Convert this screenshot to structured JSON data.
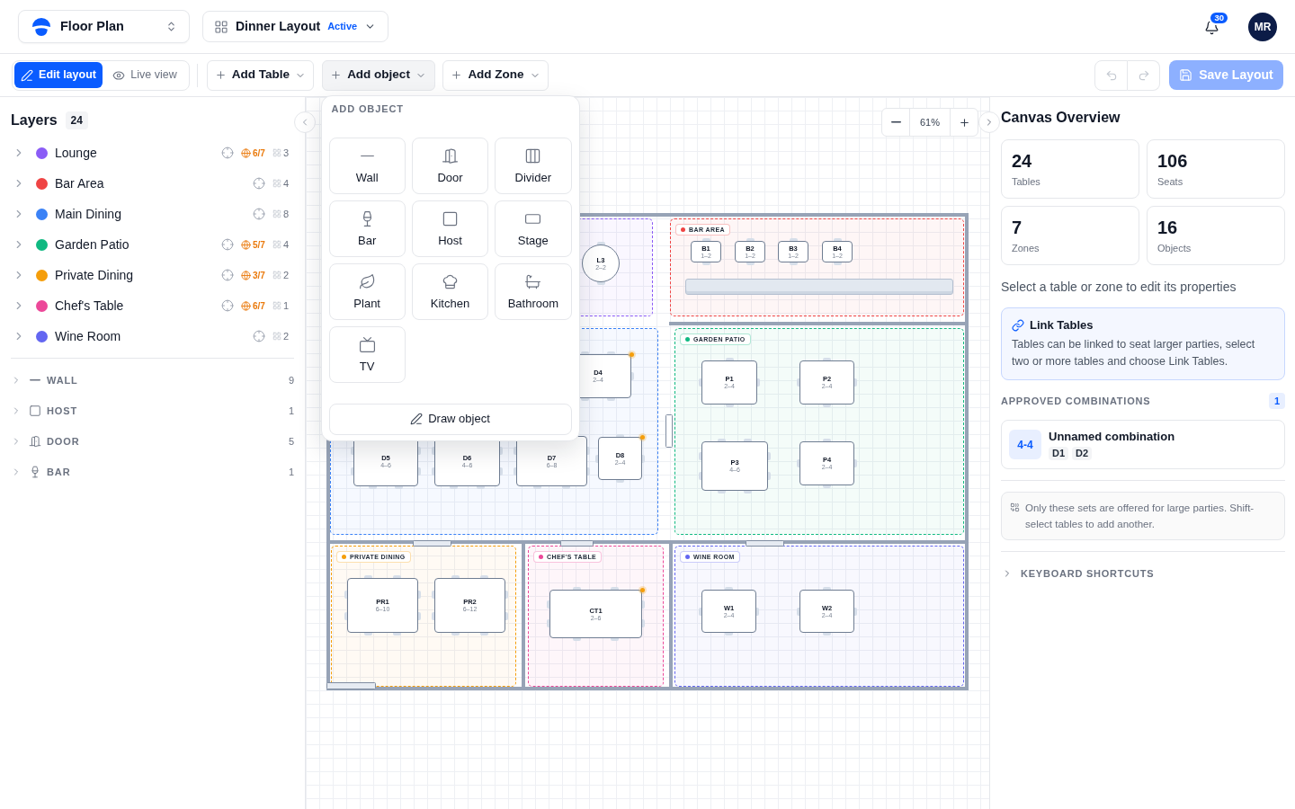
{
  "header": {
    "workspace": {
      "label": "Floor Plan"
    },
    "layout": {
      "label": "Dinner Layout",
      "status": "Active"
    },
    "notifications": {
      "count": "30"
    },
    "user": {
      "initials": "MR"
    }
  },
  "toolbar": {
    "modes": [
      {
        "label": "Edit layout",
        "selected": true
      },
      {
        "label": "Live view",
        "selected": false
      }
    ],
    "add_menus": [
      {
        "label": "Add Table",
        "open": false
      },
      {
        "label": "Add object",
        "open": true
      },
      {
        "label": "Add Zone",
        "open": false
      }
    ],
    "undo": {
      "disabled": true
    },
    "redo": {
      "disabled": true
    },
    "save": {
      "label": "Save Layout",
      "disabled": true
    }
  },
  "add_object_menu": {
    "title": "ADD OBJECT",
    "items": [
      {
        "label": "Wall"
      },
      {
        "label": "Door"
      },
      {
        "label": "Divider"
      },
      {
        "label": "Bar"
      },
      {
        "label": "Host"
      },
      {
        "label": "Stage"
      },
      {
        "label": "Plant"
      },
      {
        "label": "Kitchen"
      },
      {
        "label": "Bathroom"
      },
      {
        "label": "TV"
      }
    ],
    "draw_button": "Draw object"
  },
  "layers": {
    "title": "Layers",
    "count": "24",
    "zones": [
      {
        "name": "Lounge",
        "color": "#8b5cf6",
        "capacity": "6/7",
        "tables": "3",
        "expanded": false
      },
      {
        "name": "Bar Area",
        "color": "#ef4444",
        "tables": "4",
        "expanded": false
      },
      {
        "name": "Main Dining",
        "color": "#3b82f6",
        "tables": "8",
        "expanded": false
      },
      {
        "name": "Garden Patio",
        "color": "#10b981",
        "capacity": "5/7",
        "tables": "4",
        "expanded": false
      },
      {
        "name": "Private Dining",
        "color": "#f59e0b",
        "capacity": "3/7",
        "tables": "2",
        "expanded": false
      },
      {
        "name": "Chef's Table",
        "color": "#ec4899",
        "capacity": "6/7",
        "tables": "1",
        "expanded": false
      },
      {
        "name": "Wine Room",
        "color": "#6366f1",
        "tables": "2",
        "expanded": false
      }
    ],
    "object_groups": [
      {
        "label": "WALL",
        "count": "9",
        "expanded": false
      },
      {
        "label": "HOST",
        "count": "1",
        "expanded": false
      },
      {
        "label": "DOOR",
        "count": "5",
        "expanded": false
      },
      {
        "label": "BAR",
        "count": "1",
        "expanded": false
      }
    ]
  },
  "canvas": {
    "zoom": "61%",
    "zones": [
      {
        "color": "#8b5cf6",
        "tables": [
          {
            "name": "L3",
            "seats": "2–2",
            "kind": "round",
            "flagged": false
          }
        ]
      },
      {
        "label": "BAR AREA",
        "color": "#ef4444",
        "tables": [
          {
            "name": "B1",
            "seats": "1–2",
            "kind": "rect",
            "flagged": false
          },
          {
            "name": "B2",
            "seats": "1–2",
            "kind": "rect",
            "flagged": false
          },
          {
            "name": "B3",
            "seats": "1–2",
            "kind": "rect",
            "flagged": false
          },
          {
            "name": "B4",
            "seats": "1–2",
            "kind": "rect",
            "flagged": false
          }
        ]
      },
      {
        "color": "#3b82f6",
        "tables": [
          {
            "name": "D4",
            "seats": "2–4",
            "kind": "rect",
            "flagged": true
          },
          {
            "name": "D5",
            "seats": "4–6",
            "kind": "rect",
            "flagged": false
          },
          {
            "name": "D6",
            "seats": "4–6",
            "kind": "rect",
            "flagged": false
          },
          {
            "name": "D7",
            "seats": "6–8",
            "kind": "rect",
            "flagged": false
          },
          {
            "name": "D8",
            "seats": "2–4",
            "kind": "rect",
            "flagged": true
          }
        ]
      },
      {
        "label": "GARDEN PATIO",
        "color": "#10b981",
        "tables": [
          {
            "name": "P1",
            "seats": "2–4",
            "kind": "rect",
            "flagged": false
          },
          {
            "name": "P2",
            "seats": "2–4",
            "kind": "rect",
            "flagged": false
          },
          {
            "name": "P3",
            "seats": "4–6",
            "kind": "rect",
            "flagged": false
          },
          {
            "name": "P4",
            "seats": "2–4",
            "kind": "rect",
            "flagged": false
          }
        ]
      },
      {
        "label": "PRIVATE DINING",
        "color": "#f59e0b",
        "tables": [
          {
            "name": "PR1",
            "seats": "6–10",
            "kind": "rect",
            "flagged": false
          },
          {
            "name": "PR2",
            "seats": "6–12",
            "kind": "rect",
            "flagged": false
          }
        ]
      },
      {
        "label": "CHEF'S TABLE",
        "color": "#ec4899",
        "tables": [
          {
            "name": "CT1",
            "seats": "2–6",
            "kind": "rect",
            "flagged": true
          }
        ]
      },
      {
        "label": "WINE ROOM",
        "color": "#6366f1",
        "tables": [
          {
            "name": "W1",
            "seats": "2–4",
            "kind": "rect",
            "flagged": false
          },
          {
            "name": "W2",
            "seats": "2–4",
            "kind": "rect",
            "flagged": false
          }
        ]
      }
    ]
  },
  "overview": {
    "title": "Canvas Overview",
    "stats": [
      {
        "value": "24",
        "label": "Tables"
      },
      {
        "value": "106",
        "label": "Seats"
      },
      {
        "value": "7",
        "label": "Zones"
      },
      {
        "value": "16",
        "label": "Objects"
      }
    ],
    "hint": "Select a table or zone to edit its properties",
    "link_tip": {
      "title": "Link Tables",
      "text": "Tables can be linked to seat larger parties, select two or more tables and choose Link Tables."
    },
    "combinations": {
      "title": "APPROVED COMBINATIONS",
      "count": "1",
      "items": [
        {
          "capacity": "4-4",
          "name": "Unnamed combination",
          "tables": [
            "D1",
            "D2"
          ]
        }
      ]
    },
    "note": "Only these sets are offered for large parties. Shift-select tables to add another.",
    "shortcuts": {
      "label": "KEYBOARD SHORTCUTS",
      "expanded": false
    }
  }
}
